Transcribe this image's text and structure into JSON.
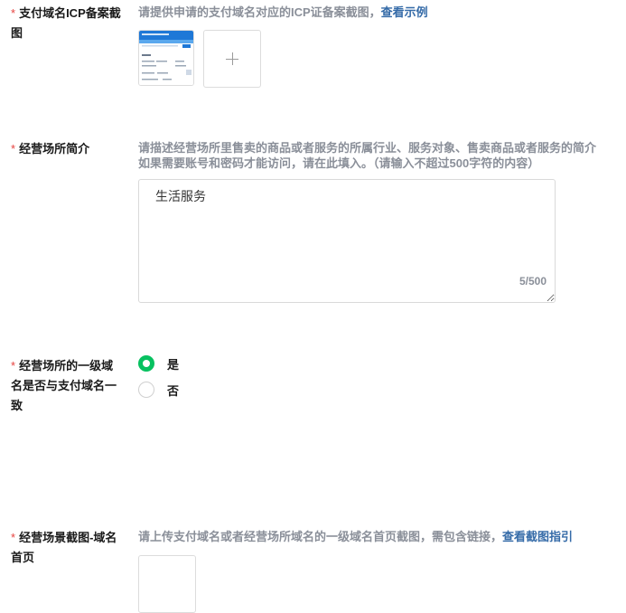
{
  "icp_section": {
    "required_mark": "*",
    "label": "支付域名ICP备案截图",
    "hint": "请提供申请的支付域名对应的ICP证备案截图，",
    "hint_link": "查看示例",
    "thumbnail": {
      "header_text": "ICP/IP地址/域名信息备案管理系统",
      "rows": [
        "主办单位",
        "网站名称",
        "备案号"
      ]
    }
  },
  "business_intro": {
    "required_mark": "*",
    "label": "经营场所简介",
    "hint_line1": "请描述经营场所里售卖的商品或者服务的所属行业、服务对象、售卖商品或者服务的简介",
    "hint_line2": "如果需要账号和密码才能访问，请在此填入。（请输入不超过500字符的内容）",
    "value": "生活服务",
    "counter": "5/500"
  },
  "domain_match": {
    "required_mark": "*",
    "label": "经营场所的一级域名是否与支付域名一致",
    "options": [
      {
        "label": "是",
        "selected": true
      },
      {
        "label": "否",
        "selected": false
      }
    ]
  },
  "screenshot_section": {
    "required_mark": "*",
    "label": "经营场景截图-域名首页",
    "hint": "请上传支付域名或者经营场所域名的一级域名首页截图，需包含链接，",
    "hint_link": "查看截图指引"
  },
  "colors": {
    "accent": "#07c160",
    "link": "#356ba8",
    "required": "#e64340",
    "hint": "#8a8f99"
  }
}
